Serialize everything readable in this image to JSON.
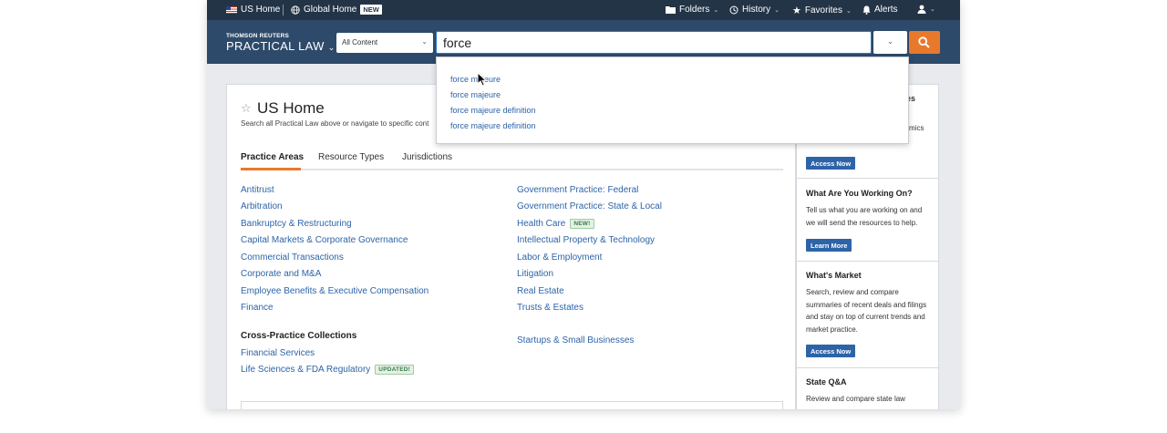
{
  "topbar": {
    "us_home": "US Home",
    "global_home": "Global Home",
    "global_badge": "NEW",
    "folders": "Folders",
    "history": "History",
    "favorites": "Favorites",
    "alerts": "Alerts"
  },
  "header": {
    "brand_top": "THOMSON REUTERS",
    "brand_main": "PRACTICAL LAW",
    "scope_label": "All Content",
    "search_value": "force",
    "colors": {
      "topbar": "#233447",
      "header": "#2e4a6a",
      "search_button": "#e8792c",
      "link": "#2d64a8"
    }
  },
  "autocomplete": {
    "items": [
      "force majeure",
      "force majeure",
      "force majeure definition",
      "force majeure definition"
    ]
  },
  "main": {
    "title": "US Home",
    "subtitle": "Search all Practical Law above or navigate to specific cont",
    "tabs": [
      "Practice Areas",
      "Resource Types",
      "Jurisdictions"
    ],
    "active_tab": "Practice Areas",
    "left_links": [
      "Antitrust",
      "Arbitration",
      "Bankruptcy & Restructuring",
      "Capital Markets & Corporate Governance",
      "Commercial Transactions",
      "Corporate and M&A",
      "Employee Benefits & Executive Compensation",
      "Finance"
    ],
    "right_links": [
      "Government Practice: Federal",
      "Government Practice: State & Local",
      "Health Care",
      "Intellectual Property & Technology",
      "Labor & Employment",
      "Litigation",
      "Real Estate",
      "Trusts & Estates"
    ],
    "health_care_badge": "NEW!",
    "cross_practice_heading": "Cross-Practice Collections",
    "cross_practice_links": [
      "Financial Services",
      "Life Sciences & FDA Regulatory"
    ],
    "life_sciences_badge": "UPDATED!",
    "startups_link": "Startups & Small Businesses"
  },
  "sidebar": {
    "frag_heading": "es",
    "frag_text": "mics",
    "section1_button": "Access Now",
    "section2": {
      "heading": "What Are You Working On?",
      "text": "Tell us what you are working on and we will send the resources to help.",
      "button": "Learn More"
    },
    "section3": {
      "heading": "What's Market",
      "text": "Search, review and compare summaries of recent deals and filings and stay on top of current trends and market practice.",
      "button": "Access Now"
    },
    "section4": {
      "heading": "State Q&A",
      "text": "Review and compare state law"
    }
  }
}
